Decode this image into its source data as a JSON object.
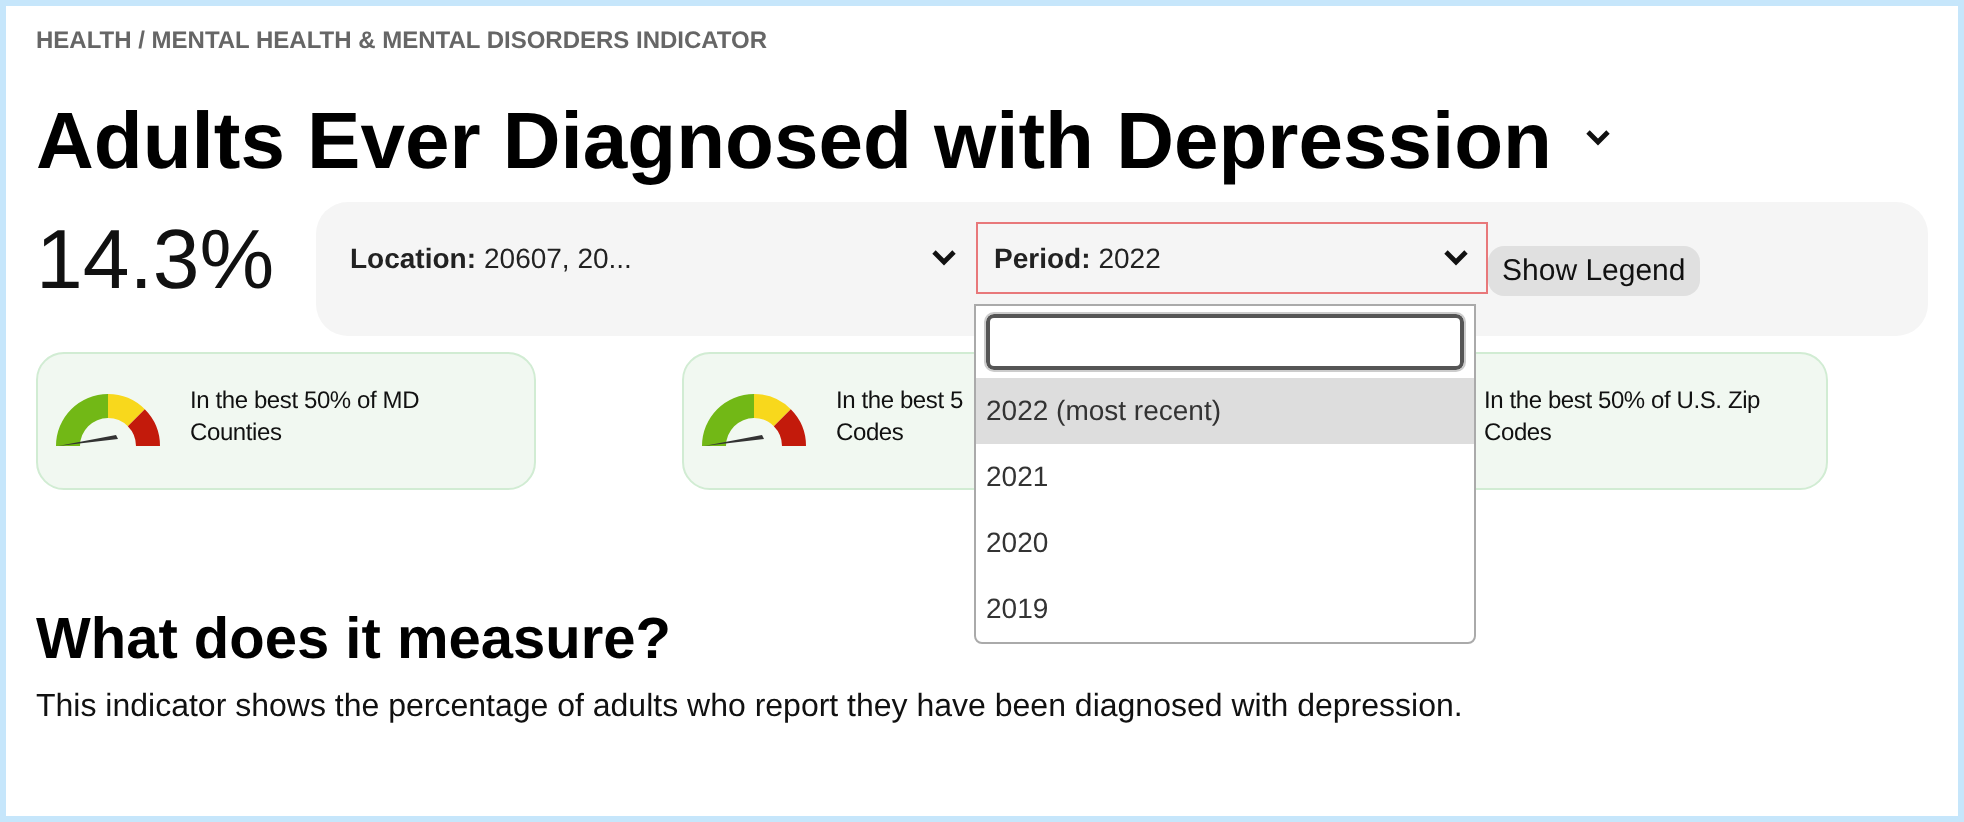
{
  "breadcrumb": "HEALTH / MENTAL HEALTH & MENTAL DISORDERS INDICATOR",
  "title": "Adults Ever Diagnosed with Depression",
  "value": "14.3%",
  "filters": [
    {
      "label": "Location:",
      "value": "20607, 20...",
      "open": false
    },
    {
      "label": "Period:",
      "value": "2022",
      "open": true
    }
  ],
  "legend_button": "Show Legend",
  "dropdown": {
    "options": [
      {
        "label": "2022 (most recent)",
        "selected": true
      },
      {
        "label": "2021",
        "selected": false
      },
      {
        "label": "2020",
        "selected": false
      },
      {
        "label": "2019",
        "selected": false
      }
    ]
  },
  "cards": [
    {
      "gauge": true,
      "lines": [
        "In the best 50% of MD",
        "Counties"
      ]
    },
    {
      "gauge": true,
      "lines": [
        "In the best 5",
        "Codes"
      ]
    },
    {
      "gauge": false,
      "lines": [
        "In the best 50% of U.S. Zip",
        "Codes"
      ]
    }
  ],
  "section_heading": "What does it measure?",
  "section_text": "This indicator shows the percentage of adults who report they have been diagnosed with depression."
}
